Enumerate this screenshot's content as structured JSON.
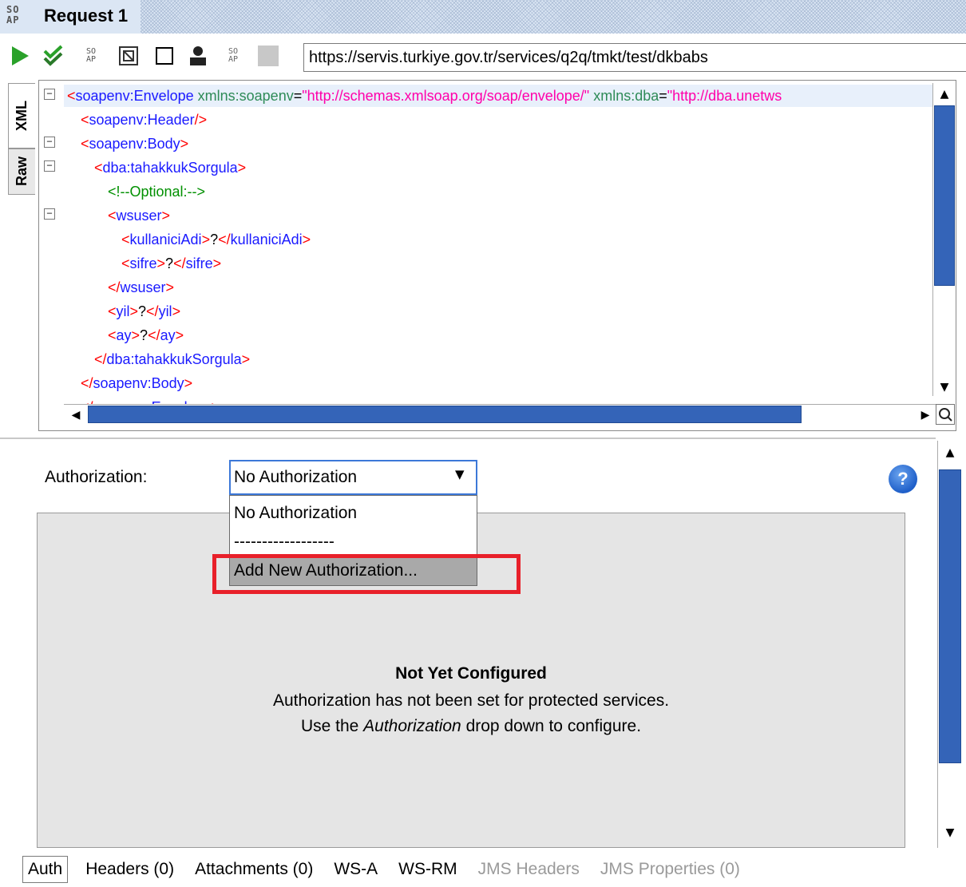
{
  "window": {
    "logo_text": "SO\nAP",
    "title": "Request 1"
  },
  "toolbar": {
    "icons": [
      "play-icon",
      "run-all-icon",
      "soap-icon",
      "format-icon",
      "stop-icon",
      "user-icon",
      "soap-small-icon",
      "disabled-square-icon"
    ],
    "endpoint_url": "https://servis.turkiye.gov.tr/services/q2q/tmkt/test/dkbabs"
  },
  "editor": {
    "tabs": [
      "XML",
      "Raw"
    ],
    "lines": [
      {
        "indent": 0,
        "parts": [
          {
            "t": "<",
            "c": "r"
          },
          {
            "t": "soapenv:Envelope",
            "c": "b"
          },
          {
            "t": " xmlns:soapenv",
            "c": "g"
          },
          {
            "t": "=",
            "c": "k"
          },
          {
            "t": "\"http://schemas.xmlsoap.org/soap/envelope/\"",
            "c": "p"
          },
          {
            "t": " xmlns:dba",
            "c": "g"
          },
          {
            "t": "=",
            "c": "k"
          },
          {
            "t": "\"http://dba.unetws",
            "c": "p"
          }
        ]
      },
      {
        "indent": 1,
        "parts": [
          {
            "t": "<",
            "c": "r"
          },
          {
            "t": "soapenv:Header",
            "c": "b"
          },
          {
            "t": "/>",
            "c": "r"
          }
        ]
      },
      {
        "indent": 1,
        "parts": [
          {
            "t": "<",
            "c": "r"
          },
          {
            "t": "soapenv:Body",
            "c": "b"
          },
          {
            "t": ">",
            "c": "r"
          }
        ]
      },
      {
        "indent": 2,
        "parts": [
          {
            "t": "<",
            "c": "r"
          },
          {
            "t": "dba:tahakkukSorgula",
            "c": "b"
          },
          {
            "t": ">",
            "c": "r"
          }
        ]
      },
      {
        "indent": 3,
        "parts": [
          {
            "t": "<!--Optional:-->",
            "c": "c"
          }
        ]
      },
      {
        "indent": 3,
        "parts": [
          {
            "t": "<",
            "c": "r"
          },
          {
            "t": "wsuser",
            "c": "b"
          },
          {
            "t": ">",
            "c": "r"
          }
        ]
      },
      {
        "indent": 4,
        "parts": [
          {
            "t": "<",
            "c": "r"
          },
          {
            "t": "kullaniciAdi",
            "c": "b"
          },
          {
            "t": ">",
            "c": "r"
          },
          {
            "t": "?",
            "c": "k"
          },
          {
            "t": "</",
            "c": "r"
          },
          {
            "t": "kullaniciAdi",
            "c": "b"
          },
          {
            "t": ">",
            "c": "r"
          }
        ]
      },
      {
        "indent": 4,
        "parts": [
          {
            "t": "<",
            "c": "r"
          },
          {
            "t": "sifre",
            "c": "b"
          },
          {
            "t": ">",
            "c": "r"
          },
          {
            "t": "?",
            "c": "k"
          },
          {
            "t": "</",
            "c": "r"
          },
          {
            "t": "sifre",
            "c": "b"
          },
          {
            "t": ">",
            "c": "r"
          }
        ]
      },
      {
        "indent": 3,
        "parts": [
          {
            "t": "</",
            "c": "r"
          },
          {
            "t": "wsuser",
            "c": "b"
          },
          {
            "t": ">",
            "c": "r"
          }
        ]
      },
      {
        "indent": 3,
        "parts": [
          {
            "t": "<",
            "c": "r"
          },
          {
            "t": "yil",
            "c": "b"
          },
          {
            "t": ">",
            "c": "r"
          },
          {
            "t": "?",
            "c": "k"
          },
          {
            "t": "</",
            "c": "r"
          },
          {
            "t": "yil",
            "c": "b"
          },
          {
            "t": ">",
            "c": "r"
          }
        ]
      },
      {
        "indent": 3,
        "parts": [
          {
            "t": "<",
            "c": "r"
          },
          {
            "t": "ay",
            "c": "b"
          },
          {
            "t": ">",
            "c": "r"
          },
          {
            "t": "?",
            "c": "k"
          },
          {
            "t": "</",
            "c": "r"
          },
          {
            "t": "ay",
            "c": "b"
          },
          {
            "t": ">",
            "c": "r"
          }
        ]
      },
      {
        "indent": 2,
        "parts": [
          {
            "t": "</",
            "c": "r"
          },
          {
            "t": "dba:tahakkukSorgula",
            "c": "b"
          },
          {
            "t": ">",
            "c": "r"
          }
        ]
      },
      {
        "indent": 1,
        "parts": [
          {
            "t": "</",
            "c": "r"
          },
          {
            "t": "soapenv:Body",
            "c": "b"
          },
          {
            "t": ">",
            "c": "r"
          }
        ]
      },
      {
        "indent": 1,
        "parts": [
          {
            "t": "</",
            "c": "r"
          },
          {
            "t": "soapenv:Envelope",
            "c": "b"
          },
          {
            "t": ">",
            "c": "r"
          }
        ]
      }
    ],
    "fold_markers": [
      "−",
      "−",
      "−",
      "−"
    ]
  },
  "auth": {
    "label": "Authorization:",
    "selected": "No Authorization",
    "dropdown_options": [
      "No Authorization",
      "------------------",
      "Add New Authorization..."
    ],
    "highlighted_option": "Add New Authorization...",
    "help_label": "?",
    "not_configured_title": "Not Yet Configured",
    "not_configured_line1": "Authorization has not been set for protected services.",
    "not_configured_line2_pre": "Use the ",
    "not_configured_line2_em": "Authorization",
    "not_configured_line2_post": " drop down to configure."
  },
  "bottom_tabs": [
    {
      "label": "Auth",
      "enabled": true,
      "active": true
    },
    {
      "label": "Headers (0)",
      "enabled": true
    },
    {
      "label": "Attachments (0)",
      "enabled": true
    },
    {
      "label": "WS-A",
      "enabled": true
    },
    {
      "label": "WS-RM",
      "enabled": true
    },
    {
      "label": "JMS Headers",
      "enabled": false
    },
    {
      "label": "JMS Properties (0)",
      "enabled": false
    }
  ],
  "colors": {
    "accent_blue": "#3464b8",
    "highlight_red": "#e8202a",
    "selected_gray": "#a9a9a9"
  }
}
